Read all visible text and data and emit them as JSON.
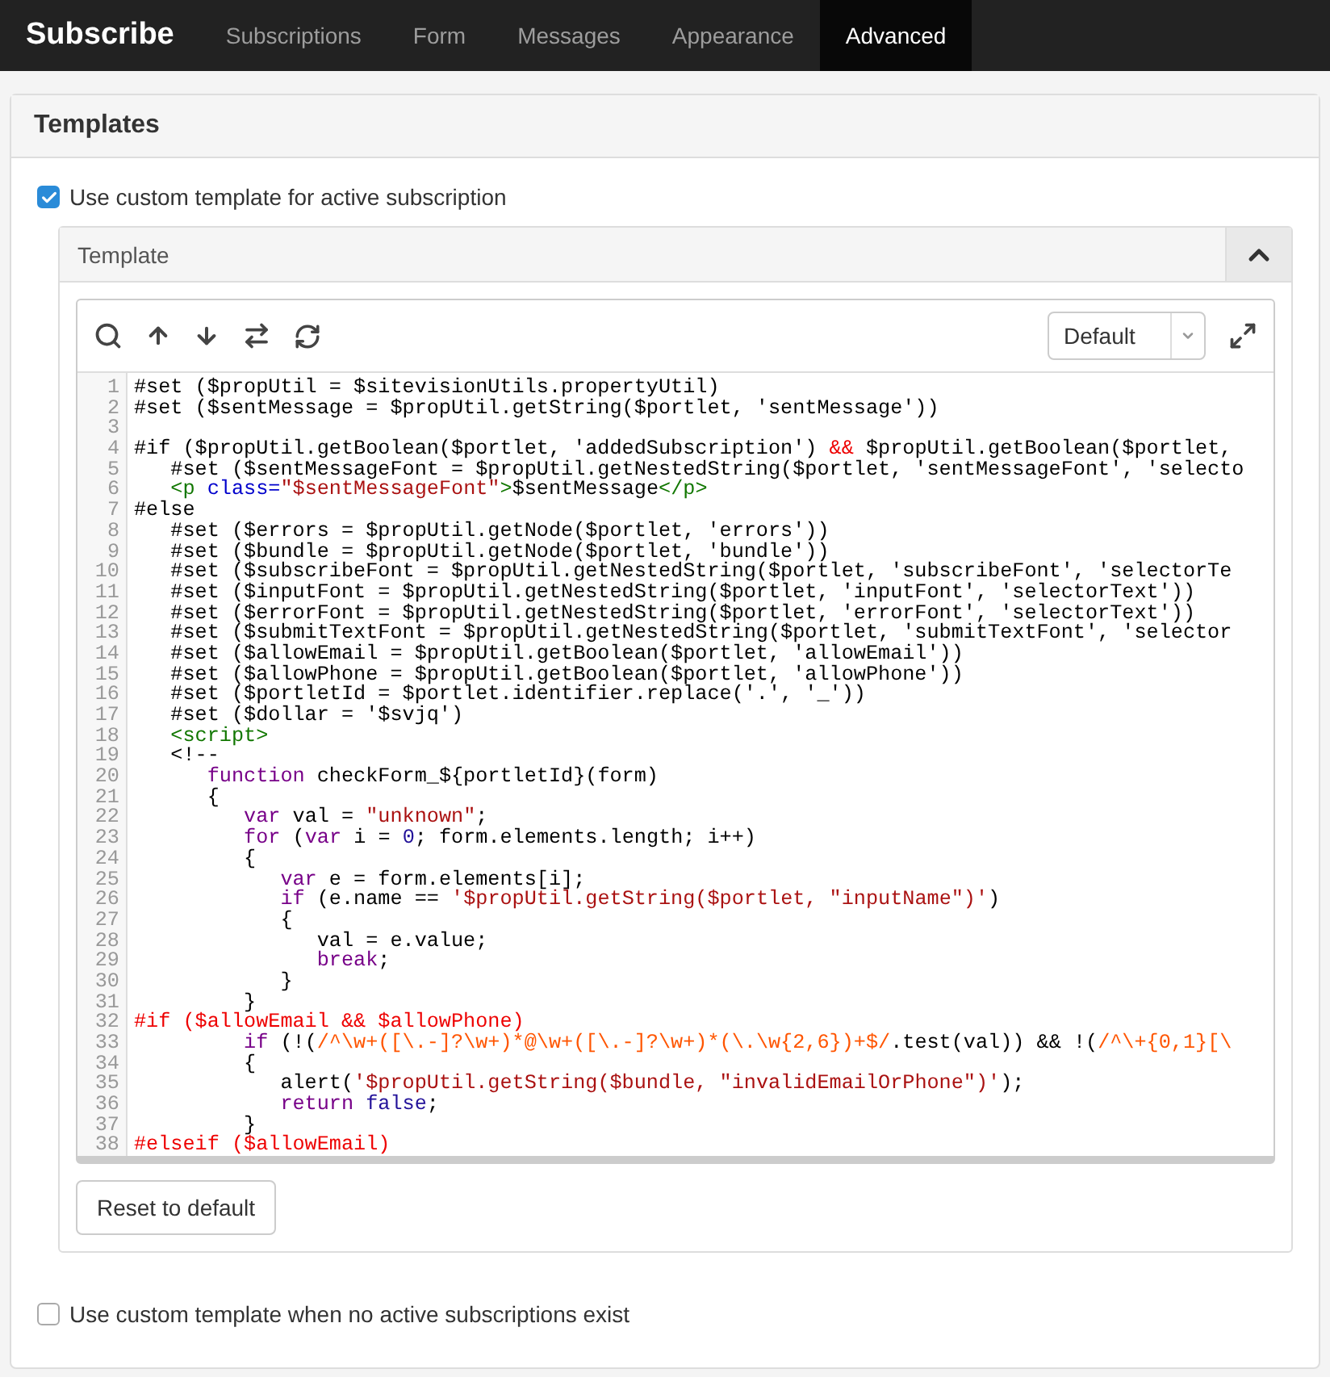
{
  "nav": {
    "brand": "Subscribe",
    "tabs": [
      {
        "label": "Subscriptions",
        "selected": false
      },
      {
        "label": "Form",
        "selected": false
      },
      {
        "label": "Messages",
        "selected": false
      },
      {
        "label": "Appearance",
        "selected": false
      },
      {
        "label": "Advanced",
        "selected": true
      }
    ]
  },
  "panel": {
    "title": "Templates",
    "active_option": {
      "label": "Use custom template for active subscription",
      "checked": true
    },
    "template": {
      "title": "Template",
      "expanded": true,
      "editor": {
        "theme_select": {
          "value": "Default"
        },
        "lines": [
          {
            "number": "1",
            "tokens": [
              {
                "kind": "plain",
                "text": "#set ($propUtil = $sitevisionUtils.propertyUtil)"
              }
            ]
          },
          {
            "number": "2",
            "tokens": [
              {
                "kind": "plain",
                "text": "#set ($sentMessage = $propUtil.getString($portlet, 'sentMessage'))"
              }
            ]
          },
          {
            "number": "3"
          },
          {
            "number": "4",
            "tokens": [
              {
                "kind": "plain",
                "text": "#if ($propUtil.getBoolean($portlet, 'addedSubscription') "
              },
              {
                "kind": "velocity",
                "text": "&&"
              },
              {
                "kind": "plain",
                "text": " $propUtil.getBoolean($portlet,"
              }
            ]
          },
          {
            "number": "5",
            "tokens": [
              {
                "kind": "plain",
                "text": "   #set ($sentMessageFont = $propUtil.getNestedString($portlet, 'sentMessageFont', 'selecto"
              }
            ]
          },
          {
            "number": "6",
            "tokens": [
              {
                "kind": "tag",
                "text": "   <p"
              },
              {
                "kind": "attribute",
                "text": " class="
              },
              {
                "kind": "string",
                "text": "\"$sentMessageFont\""
              },
              {
                "kind": "tag",
                "text": ">"
              },
              {
                "kind": "plain",
                "text": "$sentMessage"
              },
              {
                "kind": "tag",
                "text": "</p>"
              }
            ]
          },
          {
            "number": "7",
            "tokens": [
              {
                "kind": "plain",
                "text": "#else"
              }
            ]
          },
          {
            "number": "8",
            "tokens": [
              {
                "kind": "plain",
                "text": "   #set ($errors = $propUtil.getNode($portlet, 'errors'))"
              }
            ]
          },
          {
            "number": "9",
            "tokens": [
              {
                "kind": "plain",
                "text": "   #set ($bundle = $propUtil.getNode($portlet, 'bundle'))"
              }
            ]
          },
          {
            "number": "10",
            "tokens": [
              {
                "kind": "plain",
                "text": "   #set ($subscribeFont = $propUtil.getNestedString($portlet, 'subscribeFont', 'selectorTe"
              }
            ]
          },
          {
            "number": "11",
            "tokens": [
              {
                "kind": "plain",
                "text": "   #set ($inputFont = $propUtil.getNestedString($portlet, 'inputFont', 'selectorText'))"
              }
            ]
          },
          {
            "number": "12",
            "tokens": [
              {
                "kind": "plain",
                "text": "   #set ($errorFont = $propUtil.getNestedString($portlet, 'errorFont', 'selectorText'))"
              }
            ]
          },
          {
            "number": "13",
            "tokens": [
              {
                "kind": "plain",
                "text": "   #set ($submitTextFont = $propUtil.getNestedString($portlet, 'submitTextFont', 'selector"
              }
            ]
          },
          {
            "number": "14",
            "tokens": [
              {
                "kind": "plain",
                "text": "   #set ($allowEmail = $propUtil.getBoolean($portlet, 'allowEmail'))"
              }
            ]
          },
          {
            "number": "15",
            "tokens": [
              {
                "kind": "plain",
                "text": "   #set ($allowPhone = $propUtil.getBoolean($portlet, 'allowPhone'))"
              }
            ]
          },
          {
            "number": "16",
            "tokens": [
              {
                "kind": "plain",
                "text": "   #set ($portletId = $portlet.identifier.replace('.', '_'))"
              }
            ]
          },
          {
            "number": "17",
            "tokens": [
              {
                "kind": "plain",
                "text": "   #set ($dollar = '$svjq')"
              }
            ]
          },
          {
            "number": "18",
            "tokens": [
              {
                "kind": "tag",
                "text": "   <script>"
              }
            ]
          },
          {
            "number": "19",
            "tokens": [
              {
                "kind": "plain",
                "text": "   <!--"
              }
            ]
          },
          {
            "number": "20",
            "tokens": [
              {
                "kind": "keyword",
                "text": "      function"
              },
              {
                "kind": "plain",
                "text": " checkForm_${portletId}(form)"
              }
            ]
          },
          {
            "number": "21",
            "tokens": [
              {
                "kind": "plain",
                "text": "      {"
              }
            ]
          },
          {
            "number": "22",
            "tokens": [
              {
                "kind": "keyword",
                "text": "         var"
              },
              {
                "kind": "plain",
                "text": " val = "
              },
              {
                "kind": "string",
                "text": "\"unknown\""
              },
              {
                "kind": "plain",
                "text": ";"
              }
            ]
          },
          {
            "number": "23",
            "tokens": [
              {
                "kind": "keyword",
                "text": "         for"
              },
              {
                "kind": "plain",
                "text": " ("
              },
              {
                "kind": "keyword",
                "text": "var"
              },
              {
                "kind": "plain",
                "text": " i = "
              },
              {
                "kind": "atom",
                "text": "0"
              },
              {
                "kind": "plain",
                "text": "; form.elements.length; i++)"
              }
            ]
          },
          {
            "number": "24",
            "tokens": [
              {
                "kind": "plain",
                "text": "         {"
              }
            ]
          },
          {
            "number": "25",
            "tokens": [
              {
                "kind": "keyword",
                "text": "            var"
              },
              {
                "kind": "plain",
                "text": " e = form.elements[i];"
              }
            ]
          },
          {
            "number": "26",
            "tokens": [
              {
                "kind": "keyword",
                "text": "            if"
              },
              {
                "kind": "plain",
                "text": " (e.name == "
              },
              {
                "kind": "string",
                "text": "'$propUtil.getString($portlet, \"inputName\")'"
              },
              {
                "kind": "plain",
                "text": ")"
              }
            ]
          },
          {
            "number": "27",
            "tokens": [
              {
                "kind": "plain",
                "text": "            {"
              }
            ]
          },
          {
            "number": "28",
            "tokens": [
              {
                "kind": "plain",
                "text": "               val = e.value;"
              }
            ]
          },
          {
            "number": "29",
            "tokens": [
              {
                "kind": "keyword",
                "text": "               break"
              },
              {
                "kind": "plain",
                "text": ";"
              }
            ]
          },
          {
            "number": "30",
            "tokens": [
              {
                "kind": "plain",
                "text": "            }"
              }
            ]
          },
          {
            "number": "31",
            "tokens": [
              {
                "kind": "plain",
                "text": "         }"
              }
            ]
          },
          {
            "number": "32",
            "tokens": [
              {
                "kind": "velocity",
                "text": "#if ($allowEmail && $allowPhone)"
              }
            ]
          },
          {
            "number": "33",
            "tokens": [
              {
                "kind": "keyword",
                "text": "         if"
              },
              {
                "kind": "plain",
                "text": " (!("
              },
              {
                "kind": "regex",
                "text": "/^\\w+([\\.-]?\\w+)*@\\w+([\\.-]?\\w+)*(\\.\\w{2,6})+$/"
              },
              {
                "kind": "plain",
                "text": ".test(val)) && !("
              },
              {
                "kind": "regex",
                "text": "/^\\+{0,1}[\\"
              }
            ]
          },
          {
            "number": "34",
            "tokens": [
              {
                "kind": "plain",
                "text": "         {"
              }
            ]
          },
          {
            "number": "35",
            "tokens": [
              {
                "kind": "plain",
                "text": "            alert("
              },
              {
                "kind": "string",
                "text": "'$propUtil.getString($bundle, \"invalidEmailOrPhone\")'"
              },
              {
                "kind": "plain",
                "text": ");"
              }
            ]
          },
          {
            "number": "36",
            "tokens": [
              {
                "kind": "keyword",
                "text": "            return"
              },
              {
                "kind": "atom",
                "text": " false"
              },
              {
                "kind": "plain",
                "text": ";"
              }
            ]
          },
          {
            "number": "37",
            "tokens": [
              {
                "kind": "plain",
                "text": "         }"
              }
            ]
          },
          {
            "number": "38",
            "tokens": [
              {
                "kind": "velocity",
                "text": "#elseif ($allowEmail)"
              }
            ]
          }
        ]
      },
      "reset_button": "Reset to default"
    },
    "empty_option": {
      "label": "Use custom template when no active subscriptions exist",
      "checked": false
    }
  }
}
